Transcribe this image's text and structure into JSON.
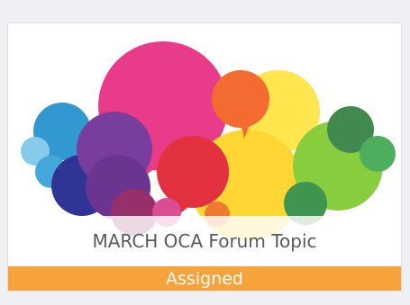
{
  "card": {
    "title": "MARCH OCA Forum Topic",
    "status": "Assigned",
    "image_icon": "speech-bubbles-icon",
    "status_color": "#f5a33a"
  }
}
